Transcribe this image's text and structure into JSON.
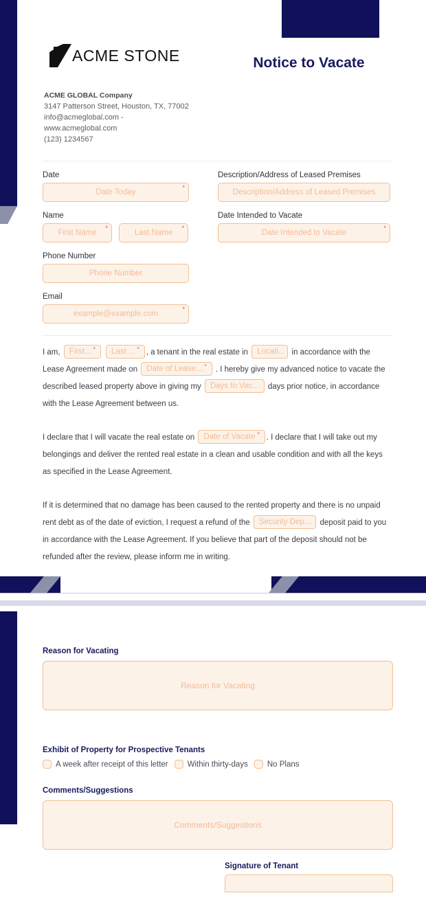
{
  "header": {
    "logo_name": "ACME STONE",
    "doc_title": "Notice to Vacate",
    "company_name": "ACME GLOBAL Company",
    "address": "3147 Patterson Street, Houston, TX, 77002",
    "email_line": "info@acmeglobal.com -",
    "website_line": "www.acmeglobal.com",
    "phone": "(123) 1234567"
  },
  "form": {
    "date_label": "Date",
    "date_placeholder": "Date Today",
    "name_label": "Name",
    "first_name_placeholder": "First Name",
    "last_name_placeholder": "Last Name",
    "phone_label": "Phone Number",
    "phone_placeholder": "Phone Number",
    "email_label": "Email",
    "email_placeholder": "example@example.com",
    "description_label": "Description/Address of Leased Premises",
    "description_placeholder": "Description/Address of Leased Premises",
    "date_vacate_label": "Date Intended to Vacate",
    "date_vacate_placeholder": "Date Intended to Vacate",
    "required_mark": "*"
  },
  "body": {
    "p1_t1": "I am,",
    "p1_first": "First...",
    "p1_last": "Last ...",
    "p1_t2": ", a tenant in the real estate in",
    "p1_location": "Locati..",
    "p1_t3": "in accordance with the Lease Agreement made on",
    "p1_lease_date": "Date of Lease...",
    "p1_t4": ". I hereby give my advanced notice to vacate the described leased property above in giving my",
    "p1_days": "Days to Vac...",
    "p1_t5": "days prior notice, in accordance with the Lease Agreement between us.",
    "p2_t1": "I declare that I will vacate the real estate on",
    "p2_date": "Date of Vacate",
    "p2_t2": ". I declare that I will take out my belongings and deliver the rented real estate in a clean and usable condition and with all the keys as specified in the Lease Agreement.",
    "p3_t1": "If it is determined that no damage has been caused to the rented property and there is no unpaid rent debt as of the date of eviction, I request a refund of the",
    "p3_security": "Security Dep...",
    "p3_t2": "deposit paid to you in accordance with the Lease Agreement. If you believe that part of the deposit should not be refunded after the review, please inform me in writing."
  },
  "page2": {
    "reason_label": "Reason for Vacating",
    "reason_placeholder": "Reason for Vacating",
    "exhibit_label": "Exhibit of Property for Prospective Tenants",
    "exhibit_options": [
      "A week after receipt of this letter",
      "Within thirty-days",
      "No Plans"
    ],
    "comments_label": "Comments/Suggestions",
    "comments_placeholder": "Comments/Suggestions",
    "signature_label": "Signature of Tenant"
  },
  "colors": {
    "navy": "#10115a",
    "title_navy": "#1a1a5e",
    "field_border": "#f2bf93",
    "field_bg": "#fdf2e8",
    "placeholder": "#f3bb95",
    "required_red": "#e2574c",
    "grey_accent": "#8c90aa"
  }
}
